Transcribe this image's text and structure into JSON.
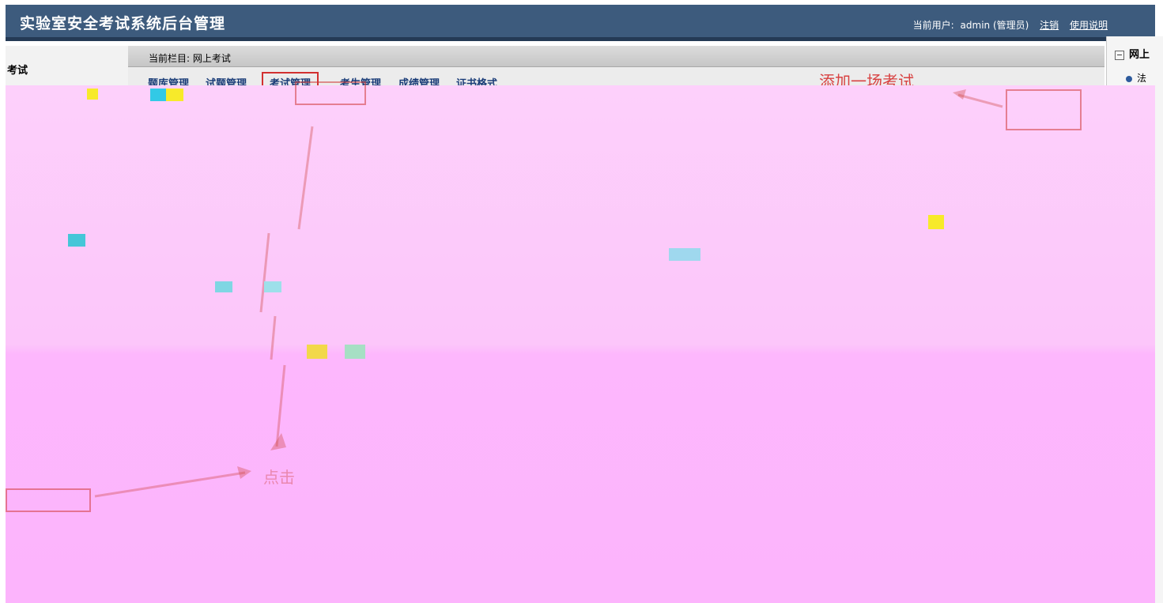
{
  "header": {
    "title": "实验室安全考试系统后台管理",
    "user_prefix": "当前用户:",
    "user_name": "admin (管理员)",
    "logout": "注销",
    "help": "使用说明"
  },
  "sidebar": {
    "title": "考试"
  },
  "breadcrumb": {
    "text": "当前栏目: 网上考试"
  },
  "tabs": [
    {
      "label": "题库管理",
      "active": false
    },
    {
      "label": "试题管理",
      "active": false
    },
    {
      "label": "考试管理",
      "active": true
    },
    {
      "label": "考生管理",
      "active": false
    },
    {
      "label": "成绩管理",
      "active": false
    },
    {
      "label": "证书格式",
      "active": false
    }
  ],
  "annotations": {
    "add_exam": "添加一场考试",
    "click": "点击"
  },
  "right_panel": {
    "heading": "网上",
    "item": "法"
  },
  "colors": {
    "header_bg": "#3d5b7d",
    "overlay_top": "#fdd0fb",
    "overlay_bottom": "#fcb4fc",
    "annotation_red": "#d84242",
    "tab_text": "#1a3c78"
  }
}
